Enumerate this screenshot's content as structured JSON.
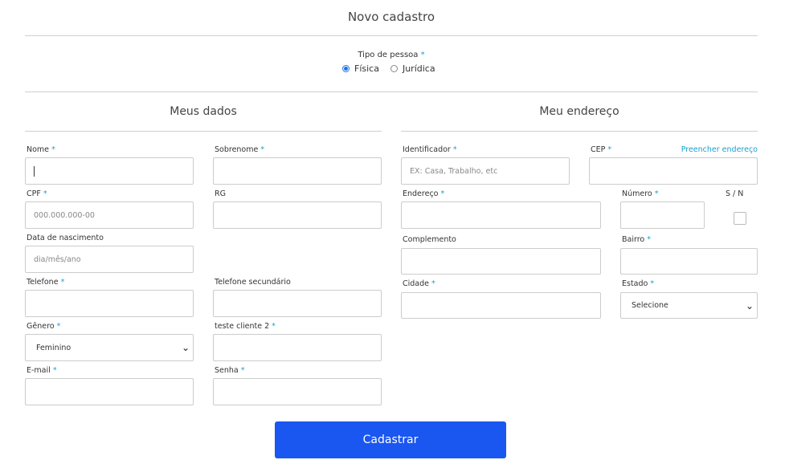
{
  "header": {
    "title": "Novo cadastro"
  },
  "tipo_pessoa": {
    "label": "Tipo de pessoa",
    "required_mark": "*",
    "options": [
      "Física",
      "Jurídica"
    ],
    "selected": "Física"
  },
  "meus_dados": {
    "title": "Meus dados",
    "nome": {
      "label": "Nome",
      "req": "*"
    },
    "sobrenome": {
      "label": "Sobrenome",
      "req": "*"
    },
    "cpf": {
      "label": "CPF",
      "req": "*",
      "placeholder": "000.000.000-00"
    },
    "rg": {
      "label": "RG"
    },
    "nascimento": {
      "label": "Data de nascimento",
      "placeholder": "dia/mês/ano"
    },
    "telefone": {
      "label": "Telefone",
      "req": "*"
    },
    "telefone2": {
      "label": "Telefone secundário"
    },
    "genero": {
      "label": "Gênero",
      "req": "*",
      "value": "Feminino"
    },
    "teste": {
      "label": "teste cliente 2",
      "req": "*"
    },
    "email": {
      "label": "E-mail",
      "req": "*"
    },
    "senha": {
      "label": "Senha",
      "req": "*"
    }
  },
  "endereco": {
    "title": "Meu endereço",
    "identificador": {
      "label": "Identificador",
      "req": "*",
      "placeholder": "EX: Casa, Trabalho, etc"
    },
    "cep": {
      "label": "CEP",
      "req": "*"
    },
    "preencher": "Preencher endereço",
    "logradouro": {
      "label": "Endereço",
      "req": "*"
    },
    "numero": {
      "label": "Número",
      "req": "*"
    },
    "sn": "S / N",
    "complemento": {
      "label": "Complemento"
    },
    "bairro": {
      "label": "Bairro",
      "req": "*"
    },
    "cidade": {
      "label": "Cidade",
      "req": "*"
    },
    "estado": {
      "label": "Estado",
      "req": "*",
      "value": "Selecione"
    }
  },
  "submit": {
    "label": "Cadastrar"
  },
  "colors": {
    "accent": "#1a56f0",
    "required": "#1a9fcf"
  }
}
